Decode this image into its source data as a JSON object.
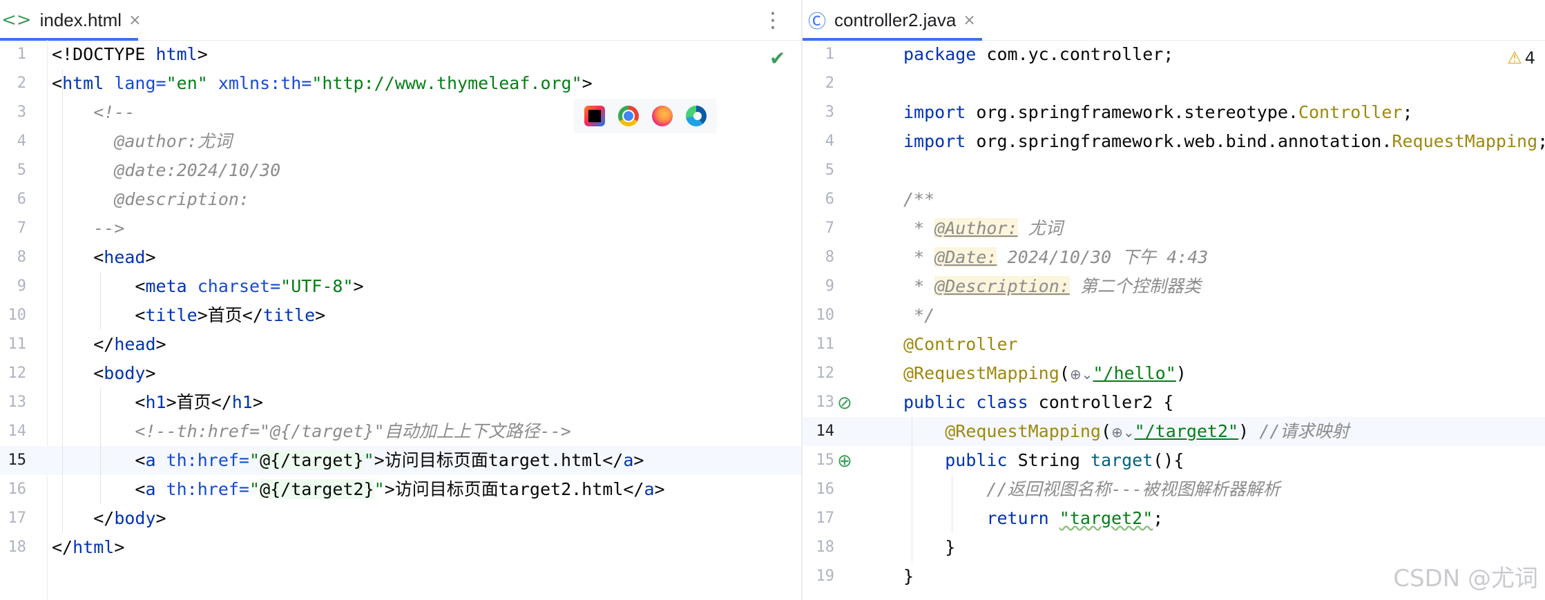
{
  "left_tab": {
    "icon": "<>",
    "label": "index.html",
    "close": "×"
  },
  "kebab": "⋮",
  "check": "✔",
  "left_lines": [
    {
      "n": "1",
      "segs": [
        {
          "t": "<!DOCTYPE "
        },
        {
          "c": "t-tag",
          "t": "html"
        },
        {
          "t": ">"
        }
      ]
    },
    {
      "n": "2",
      "segs": [
        {
          "t": "<"
        },
        {
          "c": "t-tag",
          "t": "html "
        },
        {
          "c": "t-attr",
          "t": "lang="
        },
        {
          "c": "t-val",
          "t": "\"en\" "
        },
        {
          "c": "t-attr",
          "t": "xmlns:th="
        },
        {
          "c": "t-val",
          "t": "\"http://www.thymeleaf.org\""
        },
        {
          "t": ">"
        }
      ]
    },
    {
      "n": "3",
      "segs": [
        {
          "c": "t-cmt",
          "t": "    <!--"
        }
      ]
    },
    {
      "n": "4",
      "segs": [
        {
          "c": "t-cmt",
          "t": "      @author:尤词"
        }
      ]
    },
    {
      "n": "5",
      "segs": [
        {
          "c": "t-cmt",
          "t": "      @date:2024/10/30"
        }
      ]
    },
    {
      "n": "6",
      "segs": [
        {
          "c": "t-cmt",
          "t": "      @description:"
        }
      ]
    },
    {
      "n": "7",
      "segs": [
        {
          "c": "t-cmt",
          "t": "    -->"
        }
      ]
    },
    {
      "n": "8",
      "segs": [
        {
          "t": "    <"
        },
        {
          "c": "t-tag",
          "t": "head"
        },
        {
          "t": ">"
        }
      ]
    },
    {
      "n": "9",
      "segs": [
        {
          "t": "        <"
        },
        {
          "c": "t-tag",
          "t": "meta "
        },
        {
          "c": "t-attr",
          "t": "charset="
        },
        {
          "c": "t-val",
          "t": "\"UTF-8\""
        },
        {
          "t": ">"
        }
      ]
    },
    {
      "n": "10",
      "segs": [
        {
          "t": "        <"
        },
        {
          "c": "t-tag",
          "t": "title"
        },
        {
          "t": ">首页</"
        },
        {
          "c": "t-tag",
          "t": "title"
        },
        {
          "t": ">"
        }
      ]
    },
    {
      "n": "11",
      "segs": [
        {
          "t": "    </"
        },
        {
          "c": "t-tag",
          "t": "head"
        },
        {
          "t": ">"
        }
      ]
    },
    {
      "n": "12",
      "segs": [
        {
          "t": "    <"
        },
        {
          "c": "t-tag",
          "t": "body"
        },
        {
          "t": ">"
        }
      ]
    },
    {
      "n": "13",
      "segs": [
        {
          "t": "        <"
        },
        {
          "c": "t-tag",
          "t": "h1"
        },
        {
          "t": ">首页</"
        },
        {
          "c": "t-tag",
          "t": "h1"
        },
        {
          "t": ">"
        }
      ]
    },
    {
      "n": "14",
      "segs": [
        {
          "c": "t-cmt",
          "t": "        <!--th:href=\"@{/target}\"自动加上上下文路径-->"
        }
      ]
    },
    {
      "n": "15",
      "current": true,
      "segs": [
        {
          "t": "        <"
        },
        {
          "c": "t-tag",
          "t": "a "
        },
        {
          "c": "t-attr",
          "t": "th:href="
        },
        {
          "c": "t-val",
          "t": "\""
        },
        {
          "c": "t-expr",
          "t": "@{/target}"
        },
        {
          "c": "t-val",
          "t": "\""
        },
        {
          "t": ">访问目标页面target.html</"
        },
        {
          "c": "t-tag",
          "t": "a"
        },
        {
          "t": ">"
        }
      ]
    },
    {
      "n": "16",
      "segs": [
        {
          "t": "        <"
        },
        {
          "c": "t-tag",
          "t": "a "
        },
        {
          "c": "t-attr",
          "t": "th:href="
        },
        {
          "c": "t-val",
          "t": "\""
        },
        {
          "c": "t-expr",
          "t": "@{/target2}"
        },
        {
          "c": "t-val",
          "t": "\""
        },
        {
          "t": ">访问目标页面target2.html</"
        },
        {
          "c": "t-tag",
          "t": "a"
        },
        {
          "t": ">"
        }
      ]
    },
    {
      "n": "17",
      "segs": [
        {
          "t": "    </"
        },
        {
          "c": "t-tag",
          "t": "body"
        },
        {
          "t": ">"
        }
      ]
    },
    {
      "n": "18",
      "segs": [
        {
          "t": "</"
        },
        {
          "c": "t-tag",
          "t": "html"
        },
        {
          "t": ">"
        }
      ]
    }
  ],
  "right_tab": {
    "icon": "Ⓒ",
    "label": "controller2.java",
    "close": "×"
  },
  "warnings": {
    "icon": "⚠",
    "count": "4"
  },
  "right_lines": [
    {
      "n": "1",
      "segs": [
        {
          "c": "t-kw",
          "t": "package "
        },
        {
          "t": "com.yc.controller;"
        }
      ]
    },
    {
      "n": "2",
      "segs": []
    },
    {
      "n": "3",
      "segs": [
        {
          "c": "t-kw",
          "t": "import "
        },
        {
          "t": "org.springframework.stereotype."
        },
        {
          "c": "t-cls",
          "t": "Controller"
        },
        {
          "t": ";"
        }
      ]
    },
    {
      "n": "4",
      "segs": [
        {
          "c": "t-kw",
          "t": "import "
        },
        {
          "t": "org.springframework.web.bind.annotation."
        },
        {
          "c": "t-cls",
          "t": "RequestMapping"
        },
        {
          "t": ";"
        }
      ]
    },
    {
      "n": "5",
      "segs": []
    },
    {
      "n": "6",
      "segs": [
        {
          "c": "t-doc",
          "t": "/**"
        }
      ]
    },
    {
      "n": "7",
      "segs": [
        {
          "c": "t-doc",
          "t": " * "
        },
        {
          "c": "t-doctag",
          "t": "@Author:"
        },
        {
          "c": "t-doc",
          "t": " 尤词"
        }
      ]
    },
    {
      "n": "8",
      "segs": [
        {
          "c": "t-doc",
          "t": " * "
        },
        {
          "c": "t-doctag",
          "t": "@Date:"
        },
        {
          "c": "t-doc",
          "t": " 2024/10/30 下午 4:43"
        }
      ]
    },
    {
      "n": "9",
      "segs": [
        {
          "c": "t-doc",
          "t": " * "
        },
        {
          "c": "t-doctag",
          "t": "@Description:"
        },
        {
          "c": "t-doc",
          "t": " 第二个控制器类"
        }
      ]
    },
    {
      "n": "10",
      "segs": [
        {
          "c": "t-doc",
          "t": " */"
        }
      ]
    },
    {
      "n": "11",
      "segs": [
        {
          "c": "t-ann",
          "t": "@Controller"
        }
      ]
    },
    {
      "n": "12",
      "segs": [
        {
          "c": "t-ann",
          "t": "@RequestMapping"
        },
        {
          "t": "("
        },
        {
          "c": "inlay-globe",
          "t": "⊕⌄"
        },
        {
          "c": "t-url",
          "t": "\"/hello\""
        },
        {
          "t": ")"
        }
      ]
    },
    {
      "n": "13",
      "segs": [
        {
          "c": "t-kw",
          "t": "public class "
        },
        {
          "t": "controller2 {"
        }
      ]
    },
    {
      "n": "14",
      "current": true,
      "segs": [
        {
          "t": "    "
        },
        {
          "c": "t-ann",
          "t": "@RequestMapping"
        },
        {
          "t": "("
        },
        {
          "c": "inlay-globe",
          "t": "⊕⌄"
        },
        {
          "c": "t-url",
          "t": "\"/target2\""
        },
        {
          "t": ") "
        },
        {
          "c": "t-cmt",
          "t": "//请求映射"
        }
      ]
    },
    {
      "n": "15",
      "segs": [
        {
          "t": "    "
        },
        {
          "c": "t-kw",
          "t": "public "
        },
        {
          "t": "String "
        },
        {
          "c": "t-fn",
          "t": "target"
        },
        {
          "t": "(){"
        }
      ]
    },
    {
      "n": "16",
      "segs": [
        {
          "c": "t-cmt",
          "t": "        //返回视图名称---被视图解析器解析"
        }
      ]
    },
    {
      "n": "17",
      "segs": [
        {
          "t": "        "
        },
        {
          "c": "t-kw",
          "t": "return "
        },
        {
          "c": "t-str t-wavy",
          "t": "\"target2\""
        },
        {
          "t": ";"
        }
      ]
    },
    {
      "n": "18",
      "segs": [
        {
          "t": "    }"
        }
      ]
    },
    {
      "n": "19",
      "segs": [
        {
          "t": "}"
        }
      ]
    }
  ],
  "gutter_icons": {
    "class_icon": "⊘",
    "method_icon": "⊕"
  },
  "watermark": "CSDN @尤词",
  "colors": {
    "accent": "#3574f0",
    "keyword": "#0033b3",
    "string": "#067d17",
    "annotation": "#9e880d",
    "comment": "#8c8c8c"
  }
}
